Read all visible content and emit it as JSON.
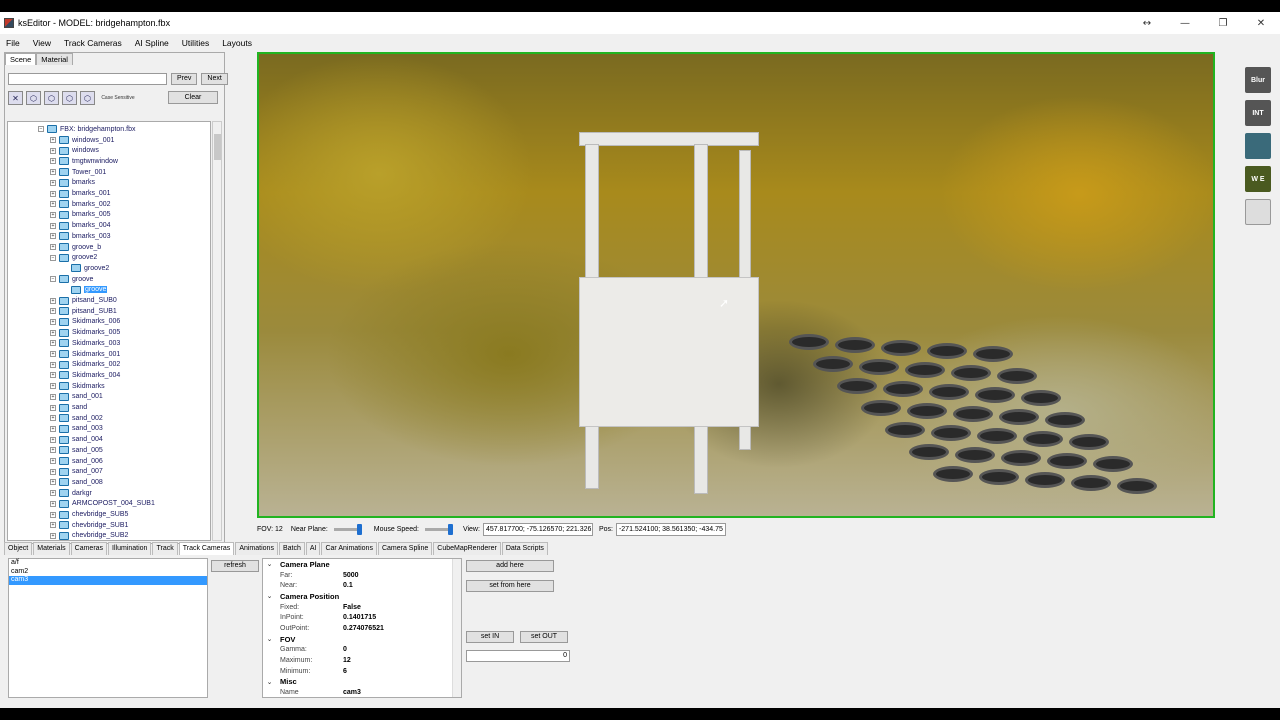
{
  "window": {
    "title": "ksEditor - MODEL: bridgehampton.fbx",
    "controls": [
      "↔",
      "—",
      "❐",
      "✕"
    ]
  },
  "menu": [
    "File",
    "View",
    "Track Cameras",
    "AI Spline",
    "Utilities",
    "Layouts"
  ],
  "left_panel": {
    "tabs": [
      "Scene",
      "Material"
    ],
    "search": {
      "value": "",
      "placeholder": ""
    },
    "prev_label": "Prev",
    "next_label": "Next",
    "case_label": "Case Sensitive",
    "clear_label": "Clear",
    "tree": [
      {
        "label": "FBX: bridgehampton.fbx",
        "depth": 0,
        "exp": "−"
      },
      {
        "label": "windows_001",
        "depth": 1,
        "exp": "+"
      },
      {
        "label": "windows",
        "depth": 1,
        "exp": "+"
      },
      {
        "label": "tmgtwnwindow",
        "depth": 1,
        "exp": "+"
      },
      {
        "label": "Tower_001",
        "depth": 1,
        "exp": "+"
      },
      {
        "label": "bmarks",
        "depth": 1,
        "exp": "+"
      },
      {
        "label": "bmarks_001",
        "depth": 1,
        "exp": "+"
      },
      {
        "label": "bmarks_002",
        "depth": 1,
        "exp": "+"
      },
      {
        "label": "bmarks_005",
        "depth": 1,
        "exp": "+"
      },
      {
        "label": "bmarks_004",
        "depth": 1,
        "exp": "+"
      },
      {
        "label": "bmarks_003",
        "depth": 1,
        "exp": "+"
      },
      {
        "label": "groove_b",
        "depth": 1,
        "exp": "+"
      },
      {
        "label": "groove2",
        "depth": 1,
        "exp": "−"
      },
      {
        "label": "groove2",
        "depth": 2,
        "exp": ""
      },
      {
        "label": "groove",
        "depth": 1,
        "exp": "−"
      },
      {
        "label": "groove",
        "depth": 2,
        "exp": "",
        "selected": true
      },
      {
        "label": "pitsand_SUB0",
        "depth": 1,
        "exp": "+"
      },
      {
        "label": "pitsand_SUB1",
        "depth": 1,
        "exp": "+"
      },
      {
        "label": "Skidmarks_006",
        "depth": 1,
        "exp": "+"
      },
      {
        "label": "Skidmarks_005",
        "depth": 1,
        "exp": "+"
      },
      {
        "label": "Skidmarks_003",
        "depth": 1,
        "exp": "+"
      },
      {
        "label": "Skidmarks_001",
        "depth": 1,
        "exp": "+"
      },
      {
        "label": "Skidmarks_002",
        "depth": 1,
        "exp": "+"
      },
      {
        "label": "Skidmarks_004",
        "depth": 1,
        "exp": "+"
      },
      {
        "label": "Skidmarks",
        "depth": 1,
        "exp": "+"
      },
      {
        "label": "sand_001",
        "depth": 1,
        "exp": "+"
      },
      {
        "label": "sand",
        "depth": 1,
        "exp": "+"
      },
      {
        "label": "sand_002",
        "depth": 1,
        "exp": "+"
      },
      {
        "label": "sand_003",
        "depth": 1,
        "exp": "+"
      },
      {
        "label": "sand_004",
        "depth": 1,
        "exp": "+"
      },
      {
        "label": "sand_005",
        "depth": 1,
        "exp": "+"
      },
      {
        "label": "sand_006",
        "depth": 1,
        "exp": "+"
      },
      {
        "label": "sand_007",
        "depth": 1,
        "exp": "+"
      },
      {
        "label": "sand_008",
        "depth": 1,
        "exp": "+"
      },
      {
        "label": "darkgr",
        "depth": 1,
        "exp": "+"
      },
      {
        "label": "ARMCOPOST_004_SUB1",
        "depth": 1,
        "exp": "+"
      },
      {
        "label": "chevbridge_SUB5",
        "depth": 1,
        "exp": "+"
      },
      {
        "label": "chevbridge_SUB1",
        "depth": 1,
        "exp": "+"
      },
      {
        "label": "chevbridge_SUB2",
        "depth": 1,
        "exp": "+"
      }
    ]
  },
  "right_tools": [
    "Blur",
    "INT",
    "",
    "W E",
    ""
  ],
  "status": {
    "fov": "FOV: 12",
    "near_label": "Near Plane:",
    "speed_label": "Mouse Speed:",
    "view_label": "View:",
    "view_value": "457.817700; -75.126570; 221.326",
    "pos_label": "Pos:",
    "pos_value": "-271.524100; 38.561350; -434.75"
  },
  "bottom_tabs": [
    "Object",
    "Materials",
    "Cameras",
    "Illumination",
    "Track",
    "Track Cameras",
    "Animations",
    "Batch",
    "AI",
    "Car Animations",
    "Camera Spline",
    "CubeMapRenderer",
    "Data Scripts"
  ],
  "active_bottom_tab": "Track Cameras",
  "cameras": [
    "a/f",
    "cam2",
    "cam3"
  ],
  "selected_camera": "cam3",
  "refresh_label": "refresh",
  "properties": [
    {
      "cat": "Camera Plane"
    },
    {
      "name": "Far:",
      "value": "5000"
    },
    {
      "name": "Near:",
      "value": "0.1"
    },
    {
      "cat": "Camera Position"
    },
    {
      "name": "Fixed:",
      "value": "False"
    },
    {
      "name": "InPoint:",
      "value": "0.1401715"
    },
    {
      "name": "OutPoint:",
      "value": "0.274076521"
    },
    {
      "cat": "FOV"
    },
    {
      "name": "Gamma:",
      "value": "0"
    },
    {
      "name": "Maximum:",
      "value": "12"
    },
    {
      "name": "Minimum:",
      "value": "6"
    },
    {
      "cat": "Misc"
    },
    {
      "name": "Name",
      "value": "cam3"
    }
  ],
  "buttons": {
    "add_here": "add here",
    "set_from_here": "set from here",
    "set_in": "set IN",
    "set_out": "set OUT"
  },
  "number_value": "0"
}
